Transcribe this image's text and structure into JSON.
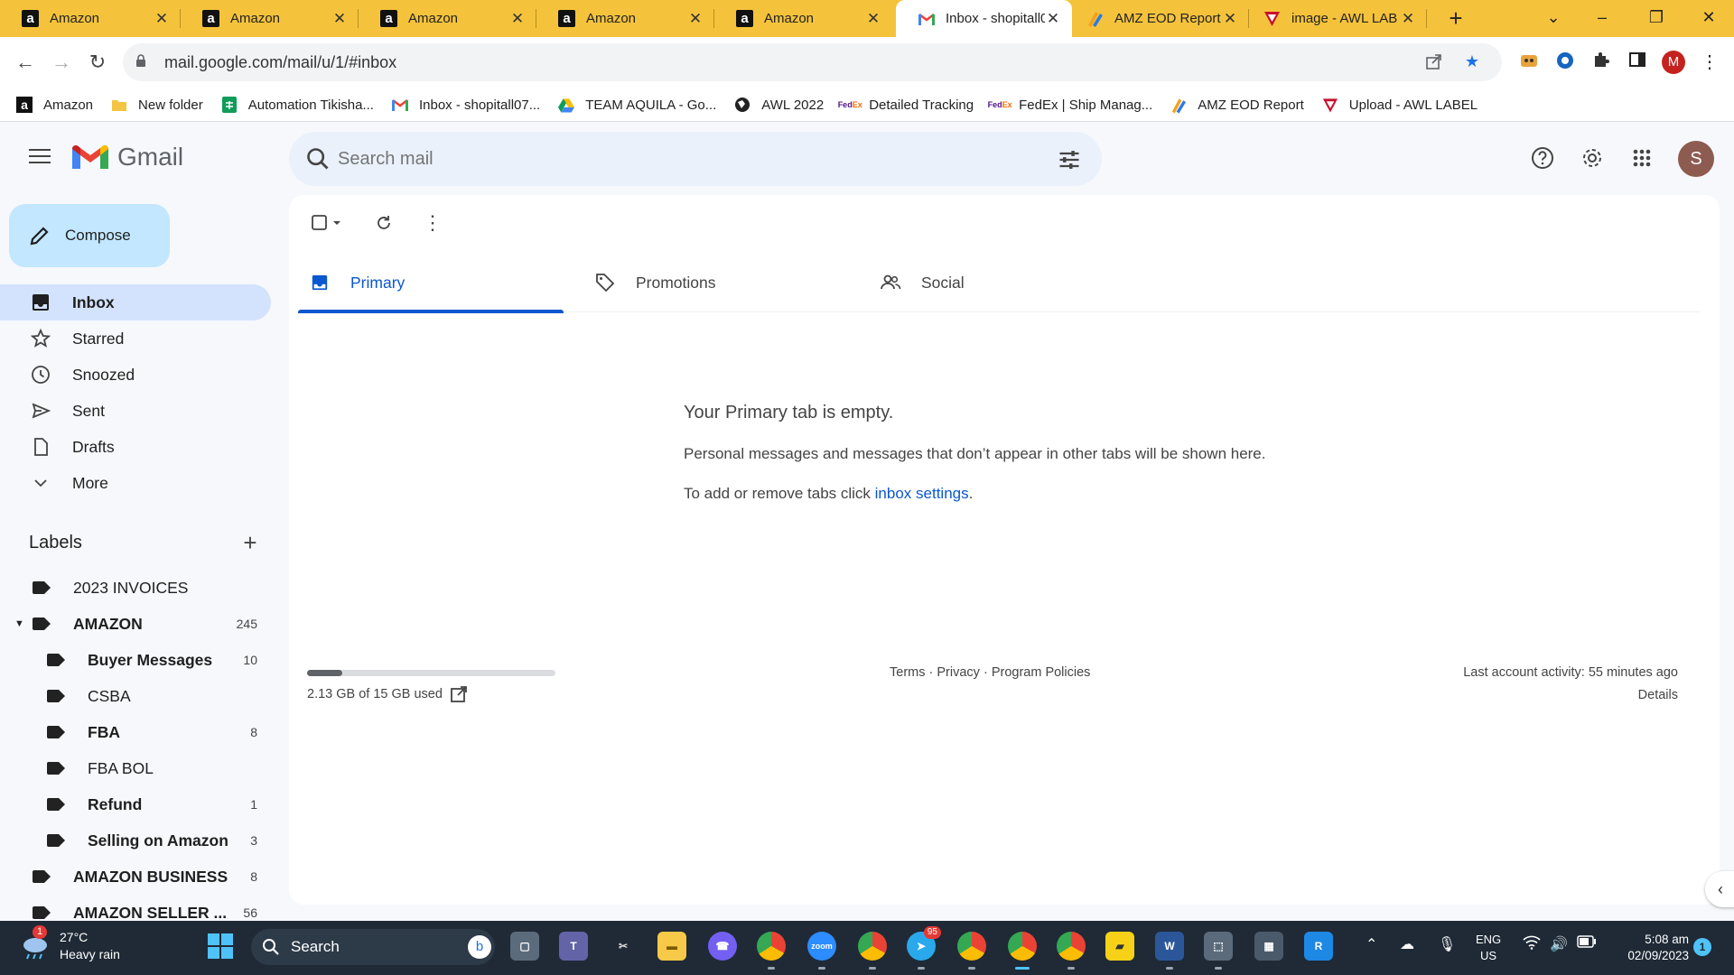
{
  "browser": {
    "tabs": [
      {
        "title": "Amazon",
        "icon": "amazon-icon"
      },
      {
        "title": "Amazon",
        "icon": "amazon-icon"
      },
      {
        "title": "Amazon",
        "icon": "amazon-icon"
      },
      {
        "title": "Amazon",
        "icon": "amazon-icon"
      },
      {
        "title": "Amazon",
        "icon": "amazon-icon"
      },
      {
        "title": "Inbox - shopitall0",
        "icon": "gmail-icon",
        "active": true
      },
      {
        "title": "AMZ EOD Report",
        "icon": "report-icon"
      },
      {
        "title": "image - AWL LAB",
        "icon": "awl-icon"
      }
    ],
    "url": "mail.google.com/mail/u/1/#inbox",
    "profile_initial": "M",
    "tab_bar_color": "#f5c33b",
    "bookmarks": [
      {
        "label": "Amazon",
        "icon": "amazon-icon"
      },
      {
        "label": "New folder",
        "icon": "folder-icon"
      },
      {
        "label": "Automation Tikisha...",
        "icon": "sheets-icon"
      },
      {
        "label": "Inbox - shopitall07...",
        "icon": "gmail-icon"
      },
      {
        "label": "TEAM AQUILA - Go...",
        "icon": "drive-icon"
      },
      {
        "label": "AWL 2022",
        "icon": "globe-icon"
      },
      {
        "label": "Detailed Tracking",
        "icon": "fedex-icon"
      },
      {
        "label": "FedEx | Ship Manag...",
        "icon": "fedex-icon"
      },
      {
        "label": "AMZ EOD Report",
        "icon": "report-icon"
      },
      {
        "label": "Upload - AWL LABEL",
        "icon": "awl-icon"
      }
    ]
  },
  "gmail": {
    "brand": "Gmail",
    "search_placeholder": "Search mail",
    "profile_initial": "S",
    "compose_label": "Compose",
    "nav": [
      {
        "label": "Inbox",
        "icon": "inbox-icon",
        "active": true
      },
      {
        "label": "Starred",
        "icon": "star-icon"
      },
      {
        "label": "Snoozed",
        "icon": "clock-icon"
      },
      {
        "label": "Sent",
        "icon": "send-icon"
      },
      {
        "label": "Drafts",
        "icon": "draft-icon"
      },
      {
        "label": "More",
        "icon": "chevron-down-icon"
      }
    ],
    "labels_title": "Labels",
    "labels": [
      {
        "name": "2023 INVOICES",
        "count": "",
        "bold": false
      },
      {
        "name": "AMAZON",
        "count": "245",
        "bold": true,
        "expanded": true
      },
      {
        "name": "Buyer Messages",
        "count": "10",
        "bold": true,
        "child": true
      },
      {
        "name": "CSBA",
        "count": "",
        "bold": false,
        "child": true
      },
      {
        "name": "FBA",
        "count": "8",
        "bold": true,
        "child": true
      },
      {
        "name": "FBA BOL",
        "count": "",
        "bold": false,
        "child": true
      },
      {
        "name": "Refund",
        "count": "1",
        "bold": true,
        "child": true
      },
      {
        "name": "Selling on Amazon",
        "count": "3",
        "bold": true,
        "child": true
      },
      {
        "name": "AMAZON BUSINESS",
        "count": "8",
        "bold": true
      },
      {
        "name": "AMAZON SELLER ...",
        "count": "56",
        "bold": true
      }
    ],
    "tabs": [
      {
        "label": "Primary",
        "icon": "inbox-icon",
        "active": true
      },
      {
        "label": "Promotions",
        "icon": "tag-icon"
      },
      {
        "label": "Social",
        "icon": "people-icon"
      }
    ],
    "empty": {
      "title": "Your Primary tab is empty.",
      "description": "Personal messages and messages that don’t appear in other tabs will be shown here.",
      "hint_prefix": "To add or remove tabs click ",
      "hint_link": "inbox settings",
      "hint_suffix": "."
    },
    "storage": {
      "text": "2.13 GB of 15 GB used",
      "used_fraction": 0.142
    },
    "footer": {
      "terms": "Terms",
      "privacy": "Privacy",
      "policies": "Program Policies",
      "sep": " · "
    },
    "activity": {
      "text": "Last account activity: 55 minutes ago",
      "details": "Details"
    }
  },
  "taskbar": {
    "weather_temp": "27°C",
    "weather_desc": "Heavy rain",
    "weather_badge": "1",
    "search_label": "Search",
    "lang_line1": "ENG",
    "lang_line2": "US",
    "time": "5:08 am",
    "date": "02/09/2023",
    "notifications": "1",
    "telegram_badge": "95"
  }
}
